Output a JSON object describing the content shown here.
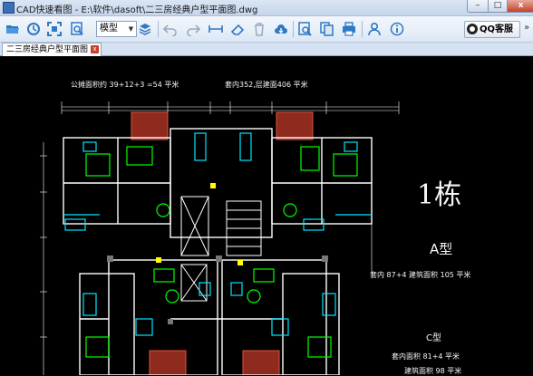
{
  "window": {
    "title": "CAD快速看图 - E:\\软件\\dasoft\\二三房经典户型平面图.dwg",
    "minimize_glyph": "–",
    "maximize_glyph": "□",
    "close_glyph": "x"
  },
  "toolbar": {
    "model_select": "模型",
    "qq_label": "QQ客服",
    "overflow_glyph": "»"
  },
  "tabs": [
    {
      "label": "二三房经典户型平面图",
      "close_glyph": "x"
    }
  ],
  "drawing": {
    "annotation_left": "公摊面积约 39+12+3 =54 平米",
    "annotation_mid": "套内352,层建面406 平米",
    "building_label": "1栋",
    "type_a_label": "A型",
    "type_a_area": "套内 87+4 建筑面积 105 平米",
    "type_c_label": "C型",
    "type_c_area": "套内面积 81+4 平米",
    "type_c_area2": "建筑面积 98 平米"
  },
  "colors": {
    "canvas_bg": "#000000",
    "wall": "#ffffff",
    "cyan": "#00e5ff",
    "green": "#00ff00",
    "red_hatch": "#c0362a",
    "yellow": "#ffff00"
  }
}
